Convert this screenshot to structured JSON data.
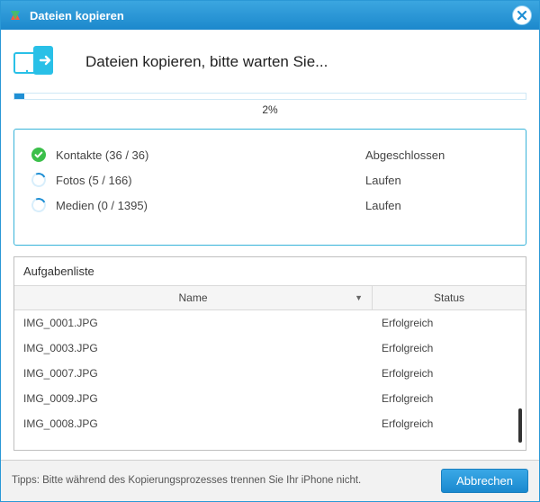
{
  "titlebar": {
    "title": "Dateien kopieren"
  },
  "header": {
    "message": "Dateien kopieren, bitte warten Sie..."
  },
  "progress": {
    "percent": 2,
    "label": "2%"
  },
  "categories": [
    {
      "icon": "check",
      "label": "Kontakte (36 / 36)",
      "status": "Abgeschlossen"
    },
    {
      "icon": "spinner",
      "label": "Fotos (5 / 166)",
      "status": "Laufen"
    },
    {
      "icon": "spinner",
      "label": "Medien (0 / 1395)",
      "status": "Laufen"
    }
  ],
  "tasklist": {
    "title": "Aufgabenliste",
    "columns": {
      "name": "Name",
      "status": "Status"
    },
    "rows": [
      {
        "name": "IMG_0001.JPG",
        "status": "Erfolgreich"
      },
      {
        "name": "IMG_0003.JPG",
        "status": "Erfolgreich"
      },
      {
        "name": "IMG_0007.JPG",
        "status": "Erfolgreich"
      },
      {
        "name": "IMG_0009.JPG",
        "status": "Erfolgreich"
      },
      {
        "name": "IMG_0008.JPG",
        "status": "Erfolgreich"
      }
    ]
  },
  "footer": {
    "tips": "Tipps: Bitte während des Kopierungsprozesses trennen Sie Ihr iPhone nicht.",
    "cancel": "Abbrechen"
  },
  "colors": {
    "accent": "#1f8fd4",
    "panel_border": "#37b3d9"
  }
}
